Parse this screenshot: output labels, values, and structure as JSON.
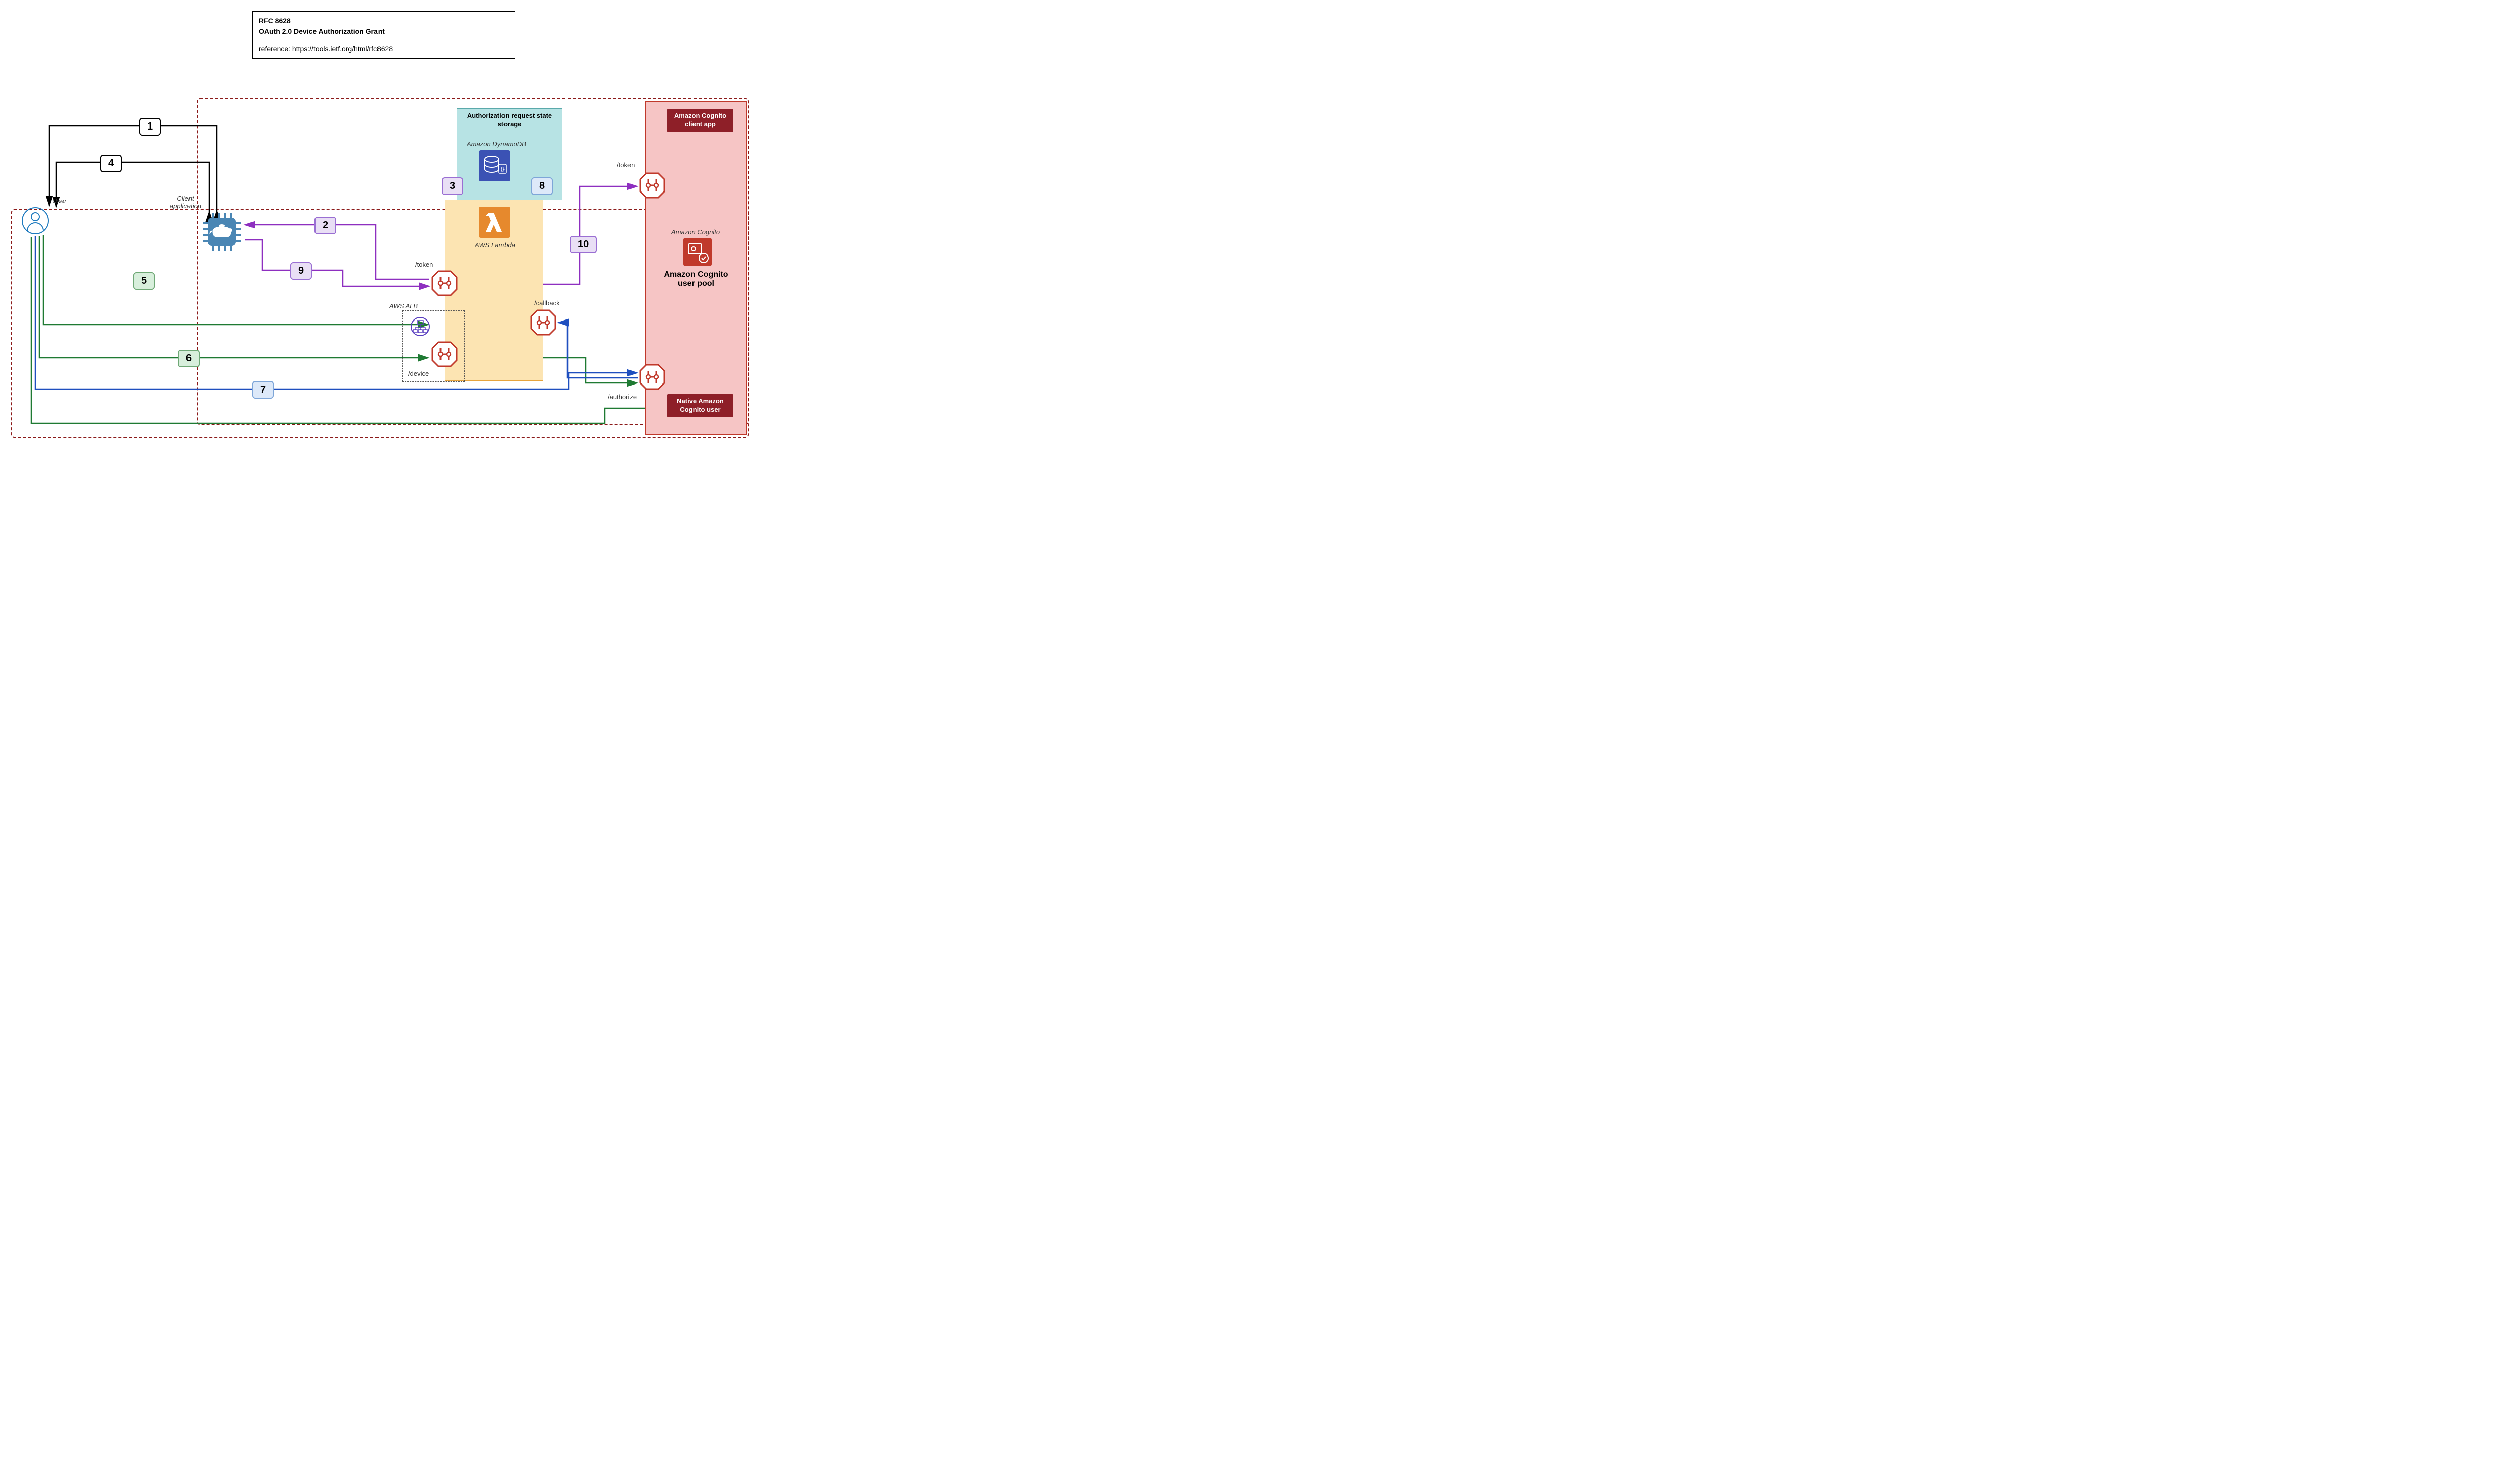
{
  "titleBox": {
    "rfc": "RFC 8628",
    "grant": "OAuth 2.0 Device Authorization Grant",
    "reference": "reference: https://tools.ietf.org/html/rfc8628"
  },
  "labels": {
    "user": "User",
    "clientApp": "Client application",
    "awsAlb": "AWS ALB",
    "awsLambda": "AWS Lambda",
    "amazonDynamoDB": "Amazon DynamoDB",
    "storageHeader": "Authorization request state storage",
    "amazonCognito": "Amazon Cognito",
    "cognitoUserPool": "Amazon Cognito user pool",
    "cognitoClientApp": "Amazon Cognito client app",
    "nativeCognitoUser": "Native Amazon Cognito user"
  },
  "endpoints": {
    "token1": "/token",
    "token2": "/token",
    "device": "/device",
    "callback": "/callback",
    "authorize": "/authorize"
  },
  "steps": {
    "s1": "1",
    "s2": "2",
    "s3": "3",
    "s4": "4",
    "s5": "5",
    "s6": "6",
    "s7": "7",
    "s8": "8",
    "s9": "9",
    "s10": "10"
  }
}
